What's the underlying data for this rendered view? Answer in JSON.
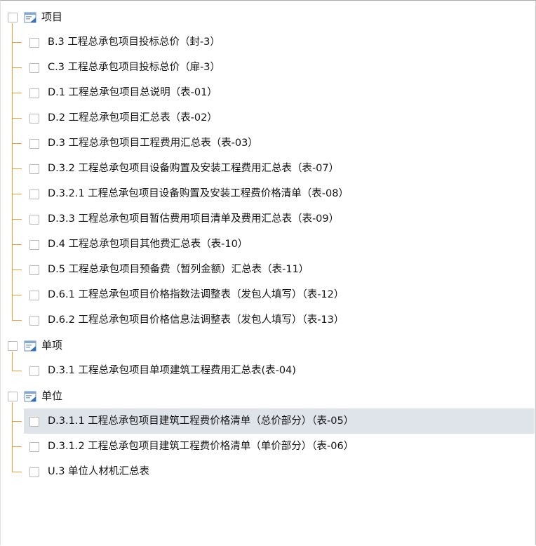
{
  "groups": [
    {
      "label": "项目",
      "items": [
        "B.3 工程总承包项目投标总价（封-3）",
        "C.3 工程总承包项目投标总价（扉-3）",
        "D.1 工程总承包项目总说明（表-01）",
        "D.2 工程总承包项目汇总表（表-02）",
        "D.3 工程总承包项目工程费用汇总表（表-03）",
        "D.3.2 工程总承包项目设备购置及安装工程费用汇总表（表-07）",
        "D.3.2.1 工程总承包项目设备购置及安装工程费价格清单（表-08）",
        "D.3.3 工程总承包项目暂估费用项目清单及费用汇总表（表-09）",
        "D.4 工程总承包项目其他费汇总表（表-10）",
        "D.5 工程总承包项目预备费（暂列金额）汇总表（表-11）",
        "D.6.1 工程总承包项目价格指数法调整表（发包人填写）（表-12）",
        "D.6.2 工程总承包项目价格信息法调整表（发包人填写）（表-13）"
      ]
    },
    {
      "label": "单项",
      "items": [
        "D.3.1 工程总承包项目单项建筑工程费用汇总表(表-04)"
      ]
    },
    {
      "label": "单位",
      "items": [
        "D.3.1.1 工程总承包项目建筑工程费价格清单（总价部分）（表-05）",
        "D.3.1.2 工程总承包项目建筑工程费价格清单（单价部分）（表-06）",
        "U.3 单位人材机汇总表"
      ]
    }
  ],
  "selected": "D.3.1.1 工程总承包项目建筑工程费价格清单（总价部分）（表-05）",
  "colors": {
    "connector": "#f0a030",
    "selection": "#dfe3ea",
    "folder_blue": "#2f6fc4"
  },
  "icons": {
    "group": "report-folder-icon",
    "checkbox": "checkbox-icon"
  }
}
